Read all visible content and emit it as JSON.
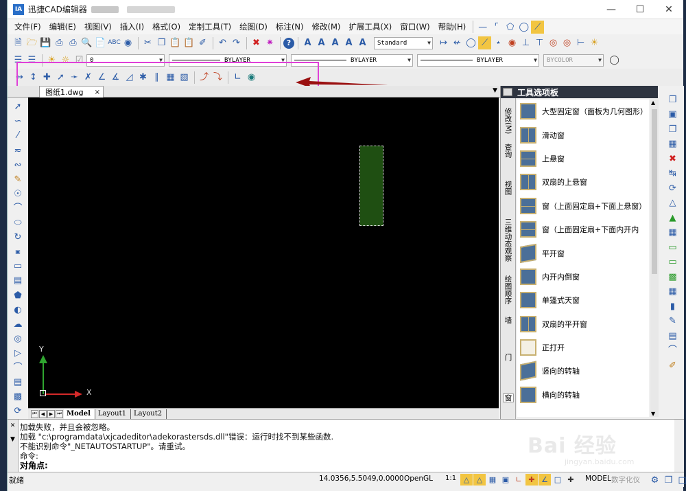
{
  "window": {
    "title": "迅捷CAD编辑器",
    "icon": "IA"
  },
  "menu": [
    "文件(F)",
    "编辑(E)",
    "视图(V)",
    "插入(I)",
    "格式(O)",
    "定制工具(T)",
    "绘图(D)",
    "标注(N)",
    "修改(M)",
    "扩展工具(X)",
    "窗口(W)",
    "帮助(H)"
  ],
  "toolbar": {
    "text_style": "Standard",
    "layer_combo": "0",
    "linetype1": "BYLAYER",
    "linetype2": "BYLAYER",
    "lineweight": "BYLAYER",
    "color": "BYCOLOR"
  },
  "document_tab": {
    "label": "图纸1.dwg",
    "close": "×"
  },
  "canvas": {
    "ucs_x": "X",
    "ucs_y": "Y"
  },
  "layout_tabs": [
    "Model",
    "Layout1",
    "Layout2"
  ],
  "palette": {
    "title": "工具选项板",
    "tabs": [
      "修改(M)",
      "查询",
      "视图",
      "三维动态观察",
      "绘图顺序",
      "墙",
      "门",
      "窗"
    ],
    "items": [
      "大型固定窗（面板为几何图形）",
      "滑动窗",
      "上悬窗",
      "双扇的上悬窗",
      "窗（上面固定扇+下面上悬窗）",
      "窗（上面固定扇+下面内开内",
      "平开窗",
      "内开内倒窗",
      "单篷式天窗",
      "双扇的平开窗",
      "正打开",
      "竖向的转轴",
      "横向的转轴"
    ]
  },
  "command": {
    "lines": [
      "加载失败，并且会被忽略。",
      "加载 \"c:\\programdata\\xjcadeditor\\adekorastersds.dll\"错误：运行时找不到某些函数.",
      "不能识别命令\"_NETAUTOSTARTUP\"。请重试。",
      "命令:"
    ],
    "prompt": "对角点:"
  },
  "status": {
    "left": "就绪",
    "coords": "14.0356,5.5049,0.0000",
    "opengl": "OpenGL",
    "scale": "1:1",
    "model": "MODEL",
    "digitizer": "数字化仪"
  },
  "watermark": {
    "main": "Bai 经验",
    "sub": "jingyan.baidu.com"
  },
  "colors": {
    "highlight": "#e040d8",
    "arrow": "#9a1010",
    "palette_header": "#2e3440"
  }
}
